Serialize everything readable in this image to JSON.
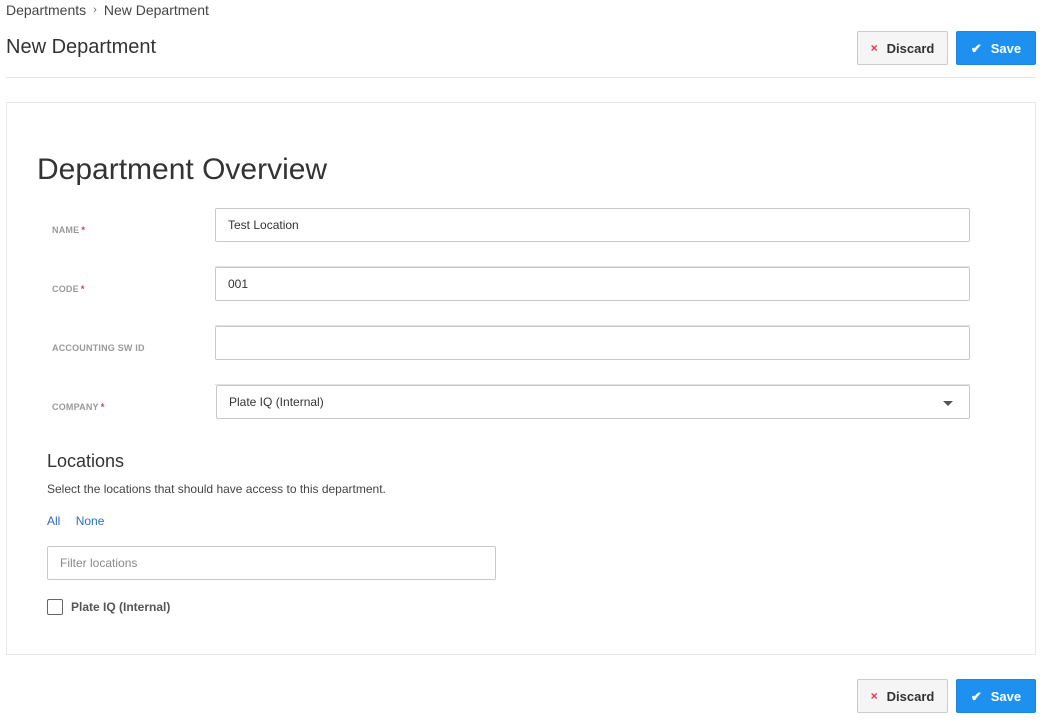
{
  "breadcrumb": {
    "parent": "Departments",
    "separator": "›",
    "current": "New Department"
  },
  "header": {
    "title": "New Department",
    "discard_label": "Discard",
    "save_label": "Save",
    "discard_icon": "×",
    "save_icon": "✔"
  },
  "overview": {
    "title": "Department Overview",
    "fields": [
      {
        "label": "NAME",
        "required": true,
        "value": "Test Location"
      },
      {
        "label": "CODE",
        "required": true,
        "value": "001"
      },
      {
        "label": "ACCOUNTING SW ID",
        "required": false,
        "value": ""
      },
      {
        "label": "COMPANY",
        "required": true,
        "value": "Plate IQ (Internal)"
      }
    ],
    "required_marker": "*"
  },
  "locations": {
    "title": "Locations",
    "description": "Select the locations that should have access to this department.",
    "select_all_label": "All",
    "select_none_label": "None",
    "filter_placeholder": "Filter locations",
    "items": [
      {
        "label": "Plate IQ (Internal)",
        "checked": false
      }
    ]
  },
  "footer": {
    "discard_label": "Discard",
    "save_label": "Save"
  },
  "colors": {
    "primary": "#1e90f0",
    "danger": "#e0344b",
    "link": "#2a6ebd"
  }
}
